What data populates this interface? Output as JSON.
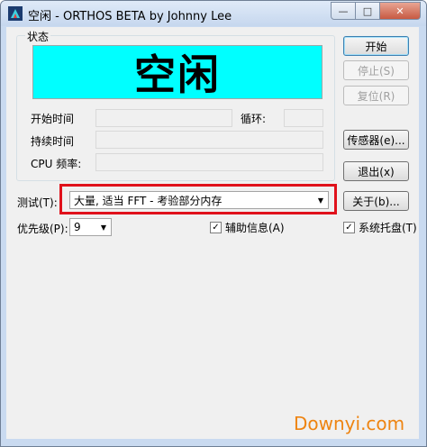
{
  "window": {
    "title": "空闲 - ORTHOS BETA by Johnny Lee",
    "app_icon": "orthos-icon"
  },
  "caption_buttons": {
    "minimize": "minimize-icon",
    "maximize": "maximize-icon",
    "close": "close-icon"
  },
  "status_group": {
    "title": "状态",
    "status_text": "空闲",
    "status_bg": "#00ffff",
    "start_time_label": "开始时间",
    "start_time_value": "",
    "loop_label": "循环:",
    "loop_value": "",
    "duration_label": "持续时间",
    "duration_value": "",
    "cpu_label": "CPU 频率:",
    "cpu_value": ""
  },
  "buttons": {
    "start": "开始",
    "stop": "停止(S)",
    "reset": "复位(R)",
    "sensors": "传感器(e)...",
    "exit": "退出(x)",
    "about": "关于(b)..."
  },
  "test": {
    "label": "测试(T):",
    "selected": "大量, 适当 FFT - 考验部分内存"
  },
  "priority": {
    "label": "优先级(P):",
    "selected": "9"
  },
  "checkboxes": {
    "aux_info": {
      "label": "辅助信息(A)",
      "checked": true
    },
    "system_tray": {
      "label": "系统托盘(T)",
      "checked": true
    }
  },
  "watermark": "Downyi.com",
  "highlight_color": "#e0111b"
}
